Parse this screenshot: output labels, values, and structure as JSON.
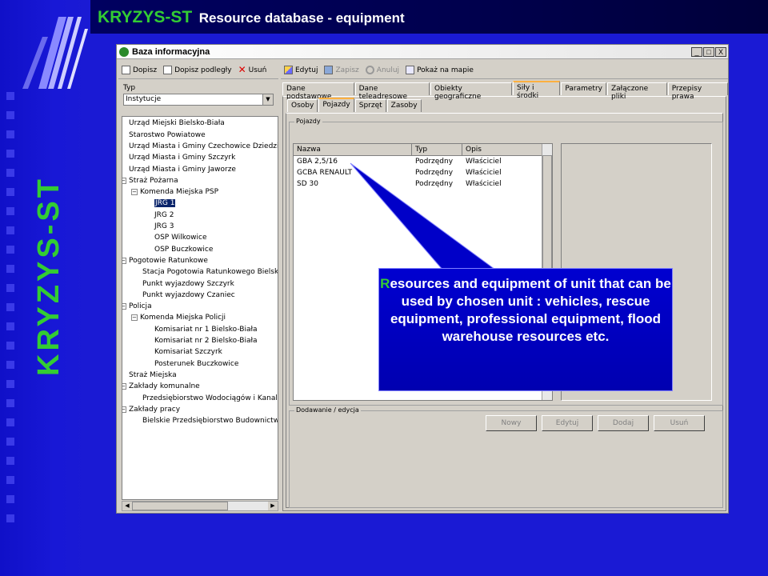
{
  "slide": {
    "title_main": "KRYZYS-ST",
    "title_sub": "Resource database - equipment",
    "vertical_title": "KRYZYS-ST",
    "logo_icon": "stripes-logo-icon"
  },
  "window": {
    "title": "Baza informacyjna",
    "controls": [
      "_",
      "□",
      "X"
    ]
  },
  "left_toolbar": {
    "add": "Dopisz",
    "add_sub": "Dopisz podległy",
    "delete": "Usuń"
  },
  "type_filter": {
    "label": "Typ",
    "value": "Instytucje"
  },
  "tree": {
    "items": [
      {
        "label": "Urząd Miejski Bielsko-Biała",
        "level": 1
      },
      {
        "label": "Starostwo Powiatowe",
        "level": 1
      },
      {
        "label": "Urząd Miasta i Gminy Czechowice Dziedzice",
        "level": 1
      },
      {
        "label": "Urząd Miasta i Gminy Szczyrk",
        "level": 1
      },
      {
        "label": "Urząd Miasta i Gminy Jaworze",
        "level": 1
      },
      {
        "label": "Straż Pożarna",
        "level": 0,
        "expander": "−"
      },
      {
        "label": "Komenda Miejska PSP",
        "level": 1,
        "expander": "−"
      },
      {
        "label": "JRG 1",
        "level": 2,
        "selected": true
      },
      {
        "label": "JRG 2",
        "level": 2
      },
      {
        "label": "JRG 3",
        "level": 2
      },
      {
        "label": "OSP Wilkowice",
        "level": 2
      },
      {
        "label": "OSP Buczkowice",
        "level": 2
      },
      {
        "label": "Pogotowie Ratunkowe",
        "level": 0,
        "expander": "−"
      },
      {
        "label": "Stacja Pogotowia Ratunkowego Bielsko-B",
        "level": 1
      },
      {
        "label": "Punkt wyjazdowy Szczyrk",
        "level": 1
      },
      {
        "label": "Punkt wyjazdowy Czaniec",
        "level": 1
      },
      {
        "label": "Policja",
        "level": 0,
        "expander": "−"
      },
      {
        "label": "Komenda Miejska Policji",
        "level": 1,
        "expander": "−"
      },
      {
        "label": "Komisariat nr 1 Bielsko-Biała",
        "level": 2
      },
      {
        "label": "Komisariat nr 2 Bielsko-Biała",
        "level": 2
      },
      {
        "label": "Komisariat Szczyrk",
        "level": 2
      },
      {
        "label": "Posterunek Buczkowice",
        "level": 2
      },
      {
        "label": "Straż Miejska",
        "level": 0
      },
      {
        "label": "Zakłady komunalne",
        "level": 0,
        "expander": "−"
      },
      {
        "label": "Przedsiębiorstwo Wodociągów i Kanalizac",
        "level": 1
      },
      {
        "label": "Zakłady pracy",
        "level": 0,
        "expander": "−"
      },
      {
        "label": "Bielskie Przedsiębiorstwo Budownictwa P",
        "level": 1
      }
    ]
  },
  "right_toolbar": {
    "edit": "Edytuj",
    "save": "Zapisz",
    "cancel": "Anuluj",
    "map": "Pokaż na mapie"
  },
  "tabs": [
    "Dane podstawowe",
    "Dane teleadresowe",
    "Obiekty geograficzne",
    "Siły i środki",
    "Parametry",
    "Załączone pliki",
    "Przepisy prawa"
  ],
  "active_tab": "Siły i środki",
  "subtabs": [
    "Osoby",
    "Pojazdy",
    "Sprzęt",
    "Zasoby"
  ],
  "active_subtab": "Pojazdy",
  "vehicles_group": {
    "title": "Pojazdy",
    "columns": [
      "Nazwa",
      "Typ",
      "Opis"
    ],
    "rows": [
      [
        "GBA 2,5/16",
        "Podrzędny",
        "Właściciel"
      ],
      [
        "GCBA RENAULT",
        "Podrzędny",
        "Właściciel"
      ],
      [
        "SD 30",
        "Podrzędny",
        "Właściciel"
      ]
    ]
  },
  "edit_group": {
    "title": "Dodawanie / edycja",
    "buttons": [
      "Nowy",
      "Edytuj",
      "Dodaj",
      "Usuń"
    ]
  },
  "callout": {
    "first_letter": "R",
    "text": "esources and equipment  of unit that can be used by chosen unit : vehicles, rescue equipment, professional equipment, flood warehouse resources etc."
  },
  "colors": {
    "background": "#1a1ad4",
    "title_green": "#33cc33",
    "callout_blue": "#0000d0"
  }
}
